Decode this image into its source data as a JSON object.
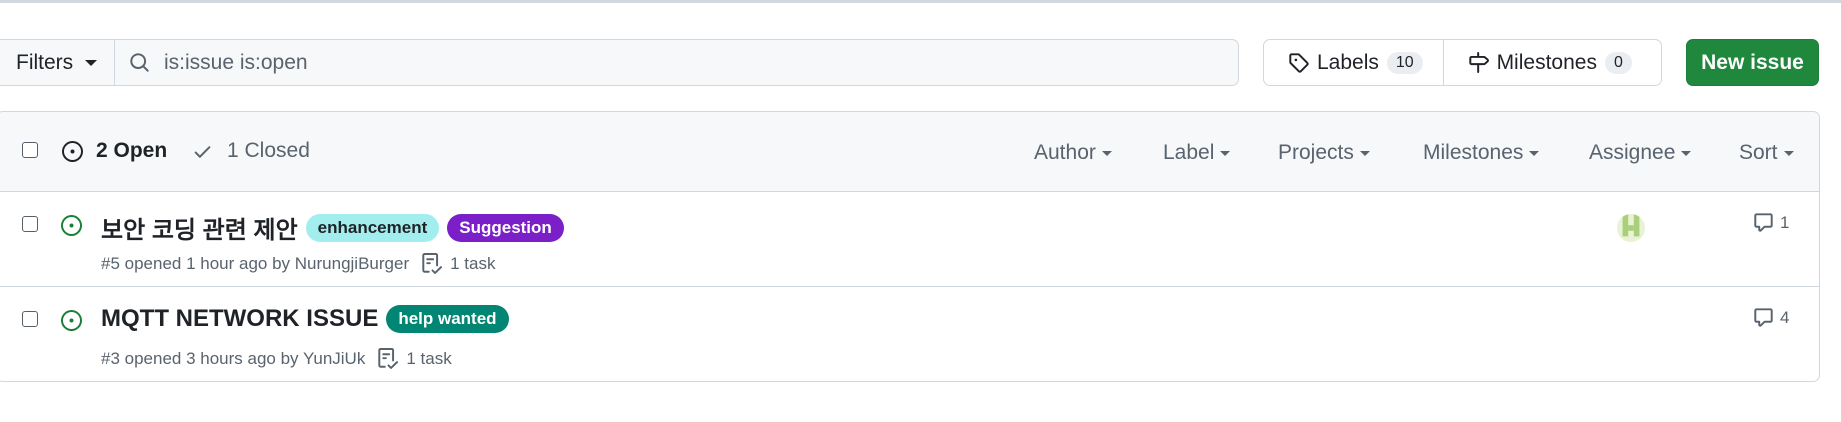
{
  "filter_bar": {
    "filters_label": "Filters",
    "search_value": "is:issue is:open",
    "labels_label": "Labels",
    "labels_count": "10",
    "milestones_label": "Milestones",
    "milestones_count": "0",
    "new_issue_label": "New issue"
  },
  "issues_header": {
    "open_label": "2 Open",
    "closed_label": "1 Closed",
    "filters": [
      "Author",
      "Label",
      "Projects",
      "Milestones",
      "Assignee",
      "Sort"
    ]
  },
  "issues": [
    {
      "title": "보안 코딩 관련 제안",
      "labels": [
        {
          "name": "enhancement",
          "bg": "#a2eeef",
          "fg": "#1f2328"
        },
        {
          "name": "Suggestion",
          "bg": "#7b20c9",
          "fg": "#ffffff"
        }
      ],
      "meta": "#5 opened 1 hour ago by NurungjiBurger",
      "tasks": "1 task",
      "comments": "1",
      "has_assignee": true
    },
    {
      "title": "MQTT NETWORK ISSUE",
      "labels": [
        {
          "name": "help wanted",
          "bg": "#008672",
          "fg": "#ffffff"
        }
      ],
      "meta": "#3 opened 3 hours ago by YunJiUk",
      "tasks": "1 task",
      "comments": "4",
      "has_assignee": false
    }
  ],
  "colors": {
    "open_icon": "#1a7f37",
    "primary_button": "#1f883d",
    "border": "#d0d7de"
  }
}
